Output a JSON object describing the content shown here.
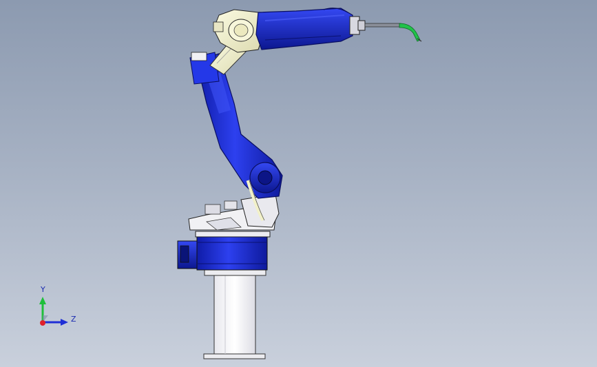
{
  "viewport": {
    "background_top": "#8c9ab0",
    "background_bottom": "#c9d0dc"
  },
  "model": {
    "primary_color": "#1f2fd6",
    "secondary_color": "#f2f1c8",
    "pedestal_color": "#f4f4f6",
    "torch_tip_color": "#22c24a"
  },
  "triad": {
    "y_label": "Y",
    "z_label": "Z",
    "y_color": "#1fbf3a",
    "z_color": "#1f2fd6",
    "x_color": "#e0202a"
  }
}
